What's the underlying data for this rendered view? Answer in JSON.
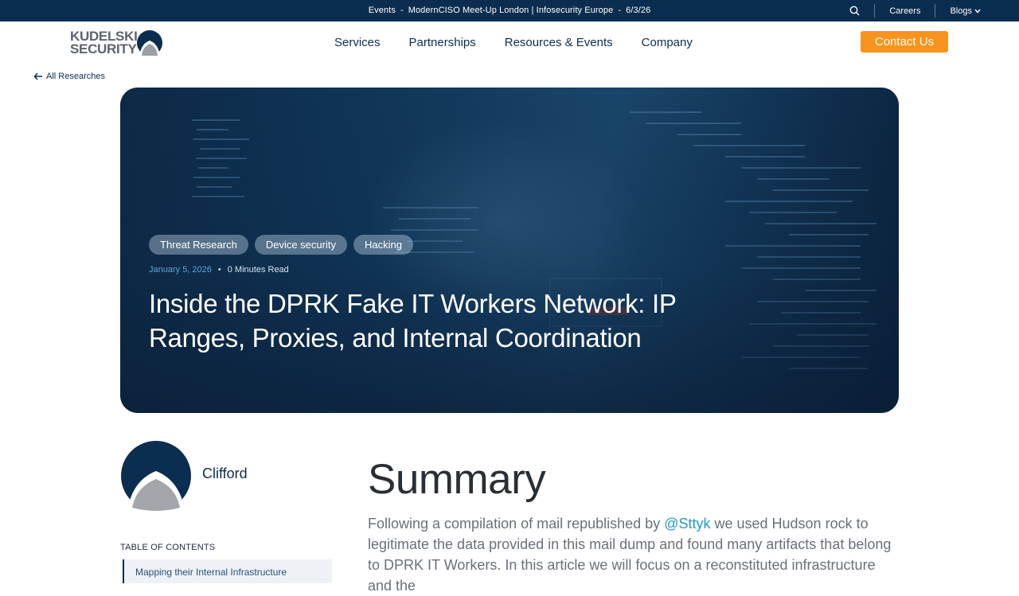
{
  "topbar": {
    "events_label": "Events",
    "event_separator": "-",
    "event_name": "ModernCISO Meet-Up London | Infosecurity Europe",
    "event_separator2": "-",
    "event_date": "6/3/26",
    "careers": "Careers",
    "blogs": "Blogs"
  },
  "header": {
    "logo_line1": "KUDELSKI",
    "logo_line2": "SECURITY",
    "nav": [
      "Services",
      "Partnerships",
      "Resources & Events",
      "Company"
    ],
    "contact": "Contact Us"
  },
  "back_link": "All Researches",
  "hero": {
    "tags": [
      "Threat Research",
      "Device security",
      "Hacking"
    ],
    "date": "January 5, 2026",
    "dot": "•",
    "read_time": "0 Minutes Read",
    "title": "Inside the DPRK Fake IT Workers Network: IP Ranges, Proxies, and Internal Coordination"
  },
  "author": {
    "name": "Clifford"
  },
  "toc": {
    "label": "TABLE OF CONTENTS",
    "first_item": "Mapping their Internal Infrastructure"
  },
  "article": {
    "heading": "Summary",
    "intro_before": "Following a compilation of mail republished by ",
    "intro_link": "@Sttyk",
    "intro_after": " we used Hudson rock to legitimate the data provided in this mail dump and found many artifacts that belong to DPRK IT Workers. In this article we will focus on a reconstituted infrastructure and the"
  },
  "colors": {
    "navy": "#0b2d4f",
    "accent_orange": "#f7941d",
    "link_blue": "#1f9bc7",
    "date_blue": "#5aa6d6"
  },
  "icons": [
    "search-icon",
    "chevron-down-icon",
    "arrow-left-icon"
  ]
}
